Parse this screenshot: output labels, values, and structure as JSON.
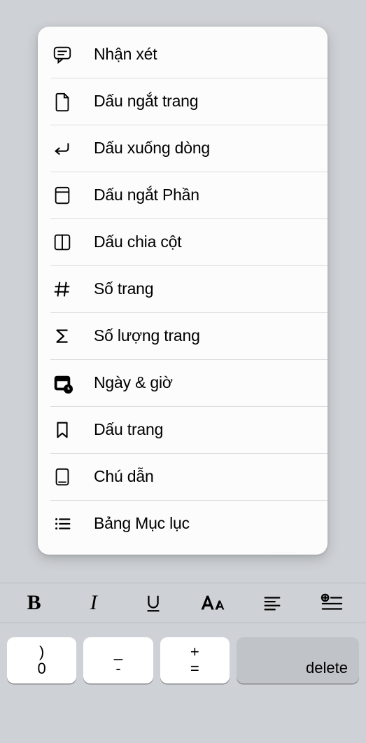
{
  "menu": {
    "items": [
      {
        "label": "Nhận xét",
        "icon": "comment-icon"
      },
      {
        "label": "Dấu ngắt trang",
        "icon": "page-break-icon"
      },
      {
        "label": "Dấu xuống dòng",
        "icon": "line-break-icon"
      },
      {
        "label": "Dấu ngắt Phần",
        "icon": "section-break-icon"
      },
      {
        "label": "Dấu chia cột",
        "icon": "column-break-icon"
      },
      {
        "label": "Số trang",
        "icon": "hash-icon"
      },
      {
        "label": "Số lượng trang",
        "icon": "sigma-icon"
      },
      {
        "label": "Ngày & giờ",
        "icon": "calendar-icon"
      },
      {
        "label": "Dấu trang",
        "icon": "bookmark-icon"
      },
      {
        "label": "Chú dẫn",
        "icon": "footnote-icon"
      },
      {
        "label": "Bảng Mục lục",
        "icon": "toc-icon"
      }
    ]
  },
  "toolbar": {
    "bold": "B",
    "italic": "I"
  },
  "keyboard": {
    "k0_top": ")",
    "k0_bottom": "0",
    "k1_top": "_",
    "k1_bottom": "-",
    "k2_top": "+",
    "k2_bottom": "=",
    "delete": "delete"
  }
}
